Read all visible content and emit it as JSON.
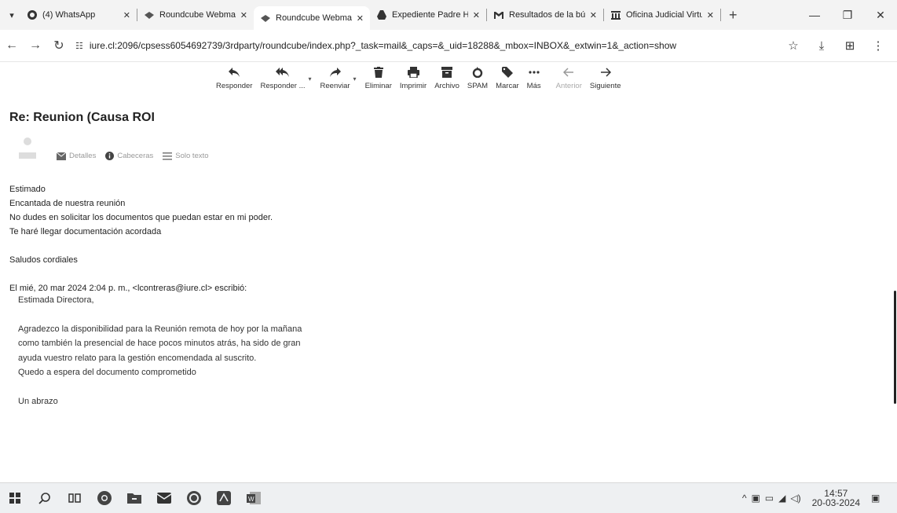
{
  "tabs": [
    {
      "title": "(4) WhatsApp",
      "icon": "whatsapp-icon",
      "active": false
    },
    {
      "title": "Roundcube Webmai",
      "icon": "roundcube-icon",
      "active": false
    },
    {
      "title": "Roundcube Webmail",
      "icon": "roundcube-icon",
      "active": true
    },
    {
      "title": "Expediente Padre Hu",
      "icon": "drive-icon",
      "active": false
    },
    {
      "title": "Resultados de la bús",
      "icon": "gmail-icon",
      "active": false
    },
    {
      "title": "Oficina Judicial Virtu",
      "icon": "court-icon",
      "active": false
    }
  ],
  "address": {
    "url": "iure.cl:2096/cpsess6054692739/3rdparty/roundcube/index.php?_task=mail&_caps=&_uid=18288&_mbox=INBOX&_extwin=1&_action=show"
  },
  "toolbar": {
    "reply": "Responder",
    "reply_all": "Responder ...",
    "forward": "Reenviar",
    "delete": "Eliminar",
    "print": "Imprimir",
    "archive": "Archivo",
    "spam": "SPAM",
    "mark": "Marcar",
    "more": "Más",
    "previous": "Anterior",
    "next": "Siguiente"
  },
  "message": {
    "subject": "Re: Reunion (Causa ROI",
    "header_links": {
      "details": "Detalles",
      "headers": "Cabeceras",
      "plain_text": "Solo texto"
    },
    "body": [
      "Estimado",
      "Encantada de nuestra reunión",
      "No dudes en solicitar los documentos que puedan estar en mi poder.",
      "Te haré llegar documentación acordada"
    ],
    "closing": "Saludos cordiales",
    "quote_header": "El mié, 20 mar 2024 2:04 p. m., <lcontreras@iure.cl> escribió:",
    "quote_greeting": "Estimada Directora,",
    "quote_body": [
      "Agradezco la disponibilidad para la Reunión remota de hoy por la mañana",
      "como también la presencial de hace pocos minutos atrás, ha sido de gran",
      "ayuda vuestro relato para la gestión encomendada al suscrito.",
      "Quedo a espera del documento comprometido"
    ],
    "quote_closing": "Un abrazo"
  },
  "taskbar": {
    "time": "14:57",
    "date": "20-03-2024"
  }
}
